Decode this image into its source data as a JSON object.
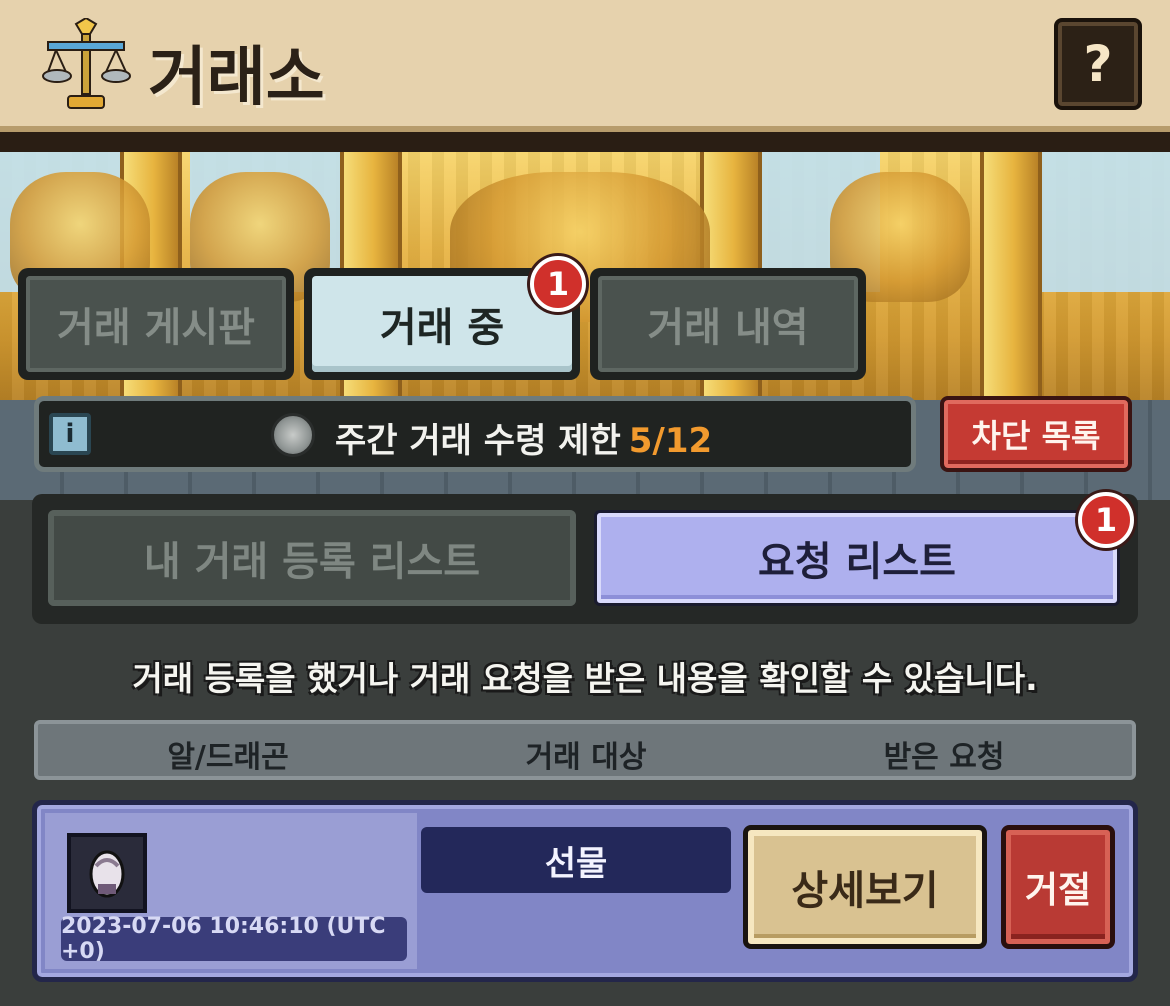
{
  "header": {
    "title": "거래소",
    "icon": "balance-scale-icon",
    "help_label": "?"
  },
  "tabs": [
    {
      "label": "거래 게시판",
      "active": false
    },
    {
      "label": "거래 중",
      "active": true,
      "badge": "1"
    },
    {
      "label": "거래 내역",
      "active": false
    }
  ],
  "limit": {
    "label": "주간 거래 수령 제한",
    "value": "5/12",
    "info_label": "i",
    "icon": "silver-coin-icon"
  },
  "block_list_label": "차단 목록",
  "subtabs": [
    {
      "label": "내 거래 등록 리스트",
      "active": false
    },
    {
      "label": "요청 리스트",
      "active": true,
      "badge": "1"
    }
  ],
  "description": "거래 등록을 했거나 거래 요청을 받은 내용을 확인할 수 있습니다.",
  "columns": [
    "알/드래곤",
    "거래 대상",
    "받은 요청"
  ],
  "rows": [
    {
      "item_icon": "egg-dragon-icon",
      "timestamp": "2023-07-06 10:46:10 (UTC +0)",
      "target": "선물",
      "detail_label": "상세보기",
      "reject_label": "거절"
    }
  ],
  "colors": {
    "accent_orange": "#f29a2e",
    "active_subtab": "#aeb0ee",
    "active_tab": "#cfe5ea",
    "badge_red": "#d0302b",
    "reject_red": "#b93a34"
  }
}
